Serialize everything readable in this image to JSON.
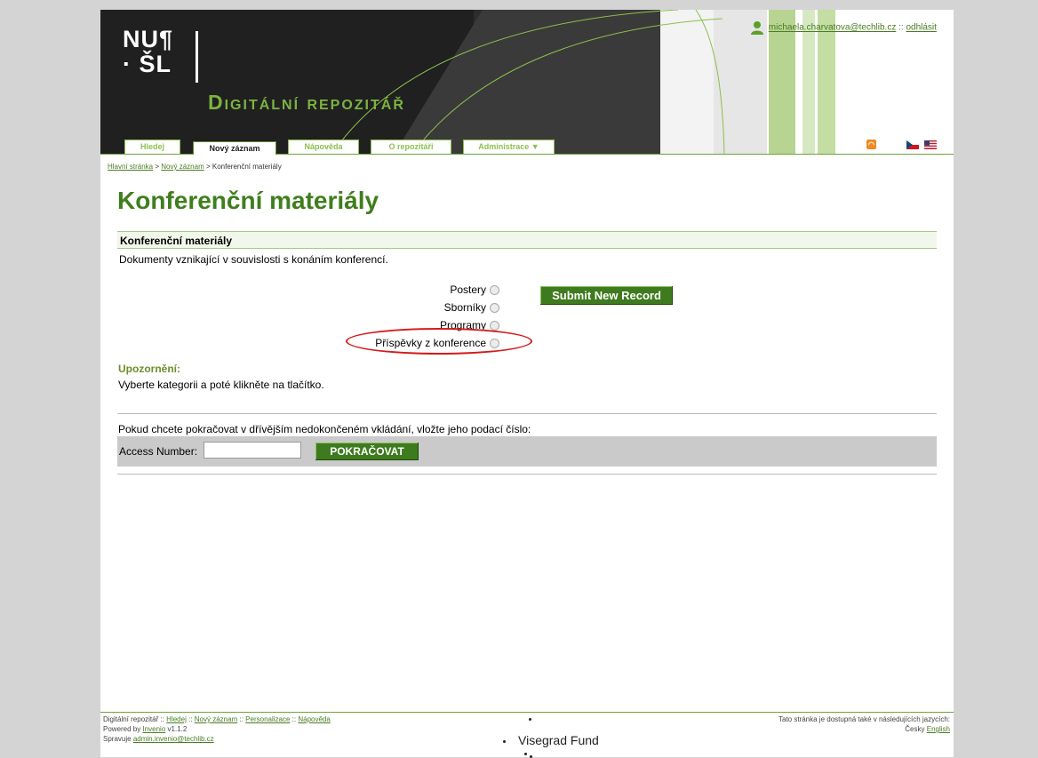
{
  "header": {
    "logo_line1": "NU¶",
    "logo_line2": "· ŠL",
    "repo_title": "Digitální repozitář",
    "user_email": "michaela.charvatova@techlib.cz",
    "separator": "::",
    "logout": "odhlásit"
  },
  "tabs": [
    {
      "label": "Hledej"
    },
    {
      "label": "Nový záznam"
    },
    {
      "label": "Nápověda"
    },
    {
      "label": "O repozitáři"
    },
    {
      "label": "Administrace ▼"
    }
  ],
  "breadcrumb": {
    "home": "Hlavní stránka",
    "sep": ">",
    "new_record": "Nový záznam",
    "current": "Konferenční materiály"
  },
  "main": {
    "title": "Konferenční materiály",
    "section_header": "Konferenční materiály",
    "section_desc": "Dokumenty vznikající v souvislosti s konáním konferencí.",
    "categories": [
      "Postery",
      "Sborníky",
      "Programy",
      "Příspěvky z konference"
    ],
    "submit_label": "Submit New Record",
    "notice_label": "Upozornění:",
    "notice_text": "Vyberte kategorii a poté klikněte na tlačítko.",
    "continue_text": "Pokud chcete pokračovat v dřívějším nedokončeném vkládání, vložte jeho podací číslo:",
    "access_label": "Access Number:",
    "access_value": "",
    "continue_button": "POKRAČOVAT"
  },
  "footer": {
    "site": "Digitální repozitář",
    "sep": "::",
    "links": [
      "Hledej",
      "Nový záznam",
      "Personalizace",
      "Nápověda"
    ],
    "powered_prefix": "Powered by",
    "powered_link": "Invenio",
    "powered_version": "v1.1.2",
    "admin_prefix": "Spravuje",
    "admin_email": "admin.invenio@techlib.cz",
    "lang_text": "Tato stránka je dostupná také v následujících jazycích:",
    "lang_current": "Česky",
    "lang_other": "English",
    "visegrad": "Visegrad Fund"
  },
  "colors": {
    "brand_green": "#3e7a1e",
    "tab_green": "#8cbf4e",
    "highlight_red": "#d41a1a"
  },
  "icons": [
    "user-icon",
    "rss-icon",
    "flag-cz-icon",
    "flag-us-icon"
  ]
}
